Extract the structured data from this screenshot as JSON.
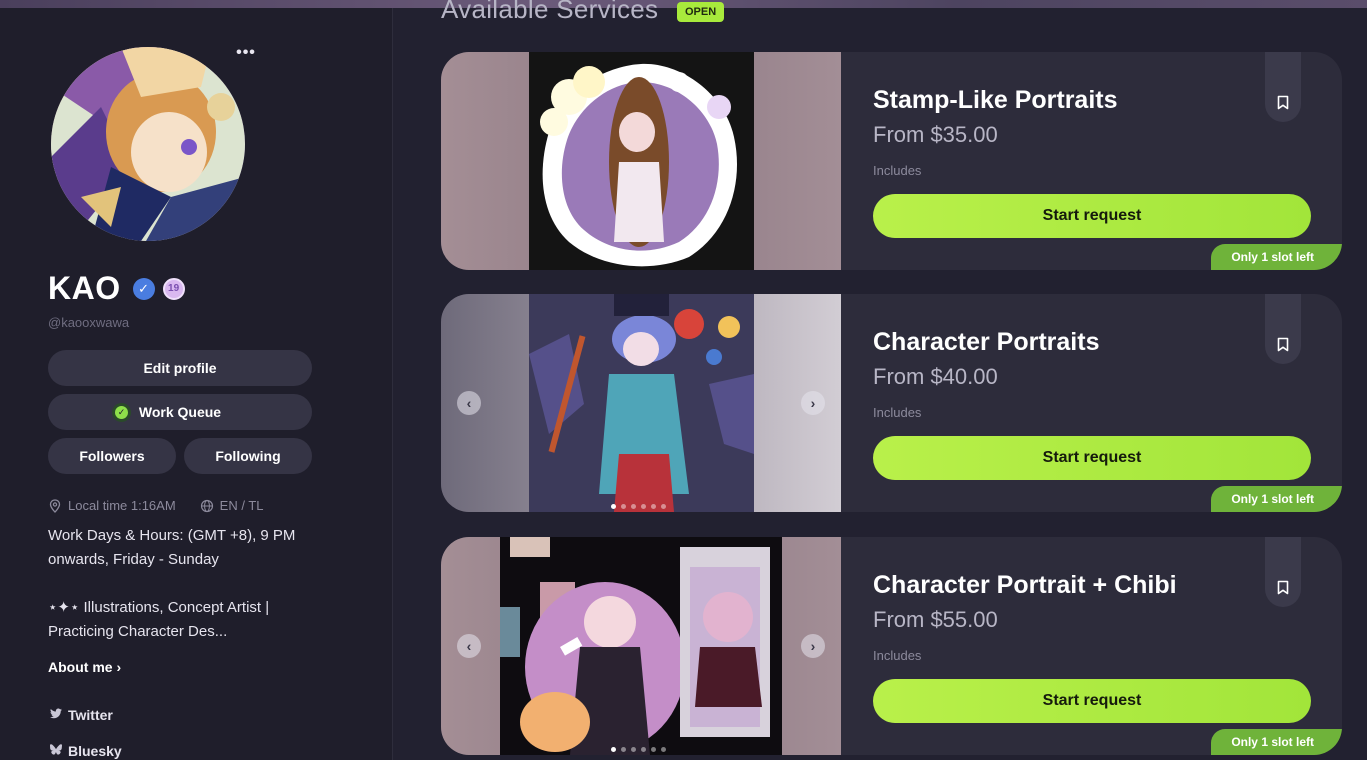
{
  "profile": {
    "name": "KAO",
    "handle": "@kaooxwawa",
    "age_badge": "19",
    "verified_icon": "check-icon",
    "edit_label": "Edit profile",
    "queue_label": "Work Queue",
    "followers_label": "Followers",
    "following_label": "Following",
    "local_time": "Local time 1:16AM",
    "languages": "EN / TL",
    "bio_hours": "Work Days & Hours: (GMT +8), 9 PM onwards, Friday - Sunday",
    "bio_intro": "⋆✦⋆ Illustrations, Concept Artist | Practicing Character Des...",
    "about_label": "About me",
    "more_label": "•••",
    "socials": [
      {
        "label": "Twitter",
        "icon": "twitter-icon"
      },
      {
        "label": "Bluesky",
        "icon": "bluesky-icon"
      }
    ]
  },
  "services": {
    "title": "Available Services",
    "status": "OPEN",
    "items": [
      {
        "title": "Stamp-Like Portraits",
        "price": "From $35.00",
        "includes": "Includes",
        "cta": "Start request",
        "slots": "Only 1 slot left"
      },
      {
        "title": "Character Portraits",
        "price": "From $40.00",
        "includes": "Includes",
        "cta": "Start request",
        "slots": "Only 1 slot left"
      },
      {
        "title": "Character Portrait + Chibi",
        "price": "From $55.00",
        "includes": "Includes",
        "cta": "Start request",
        "slots": "Only 1 slot left"
      }
    ]
  },
  "colors": {
    "accent": "#a8ea3c",
    "background": "#222130",
    "card": "#2d2c3b",
    "slot_badge": "#6fb33a"
  }
}
